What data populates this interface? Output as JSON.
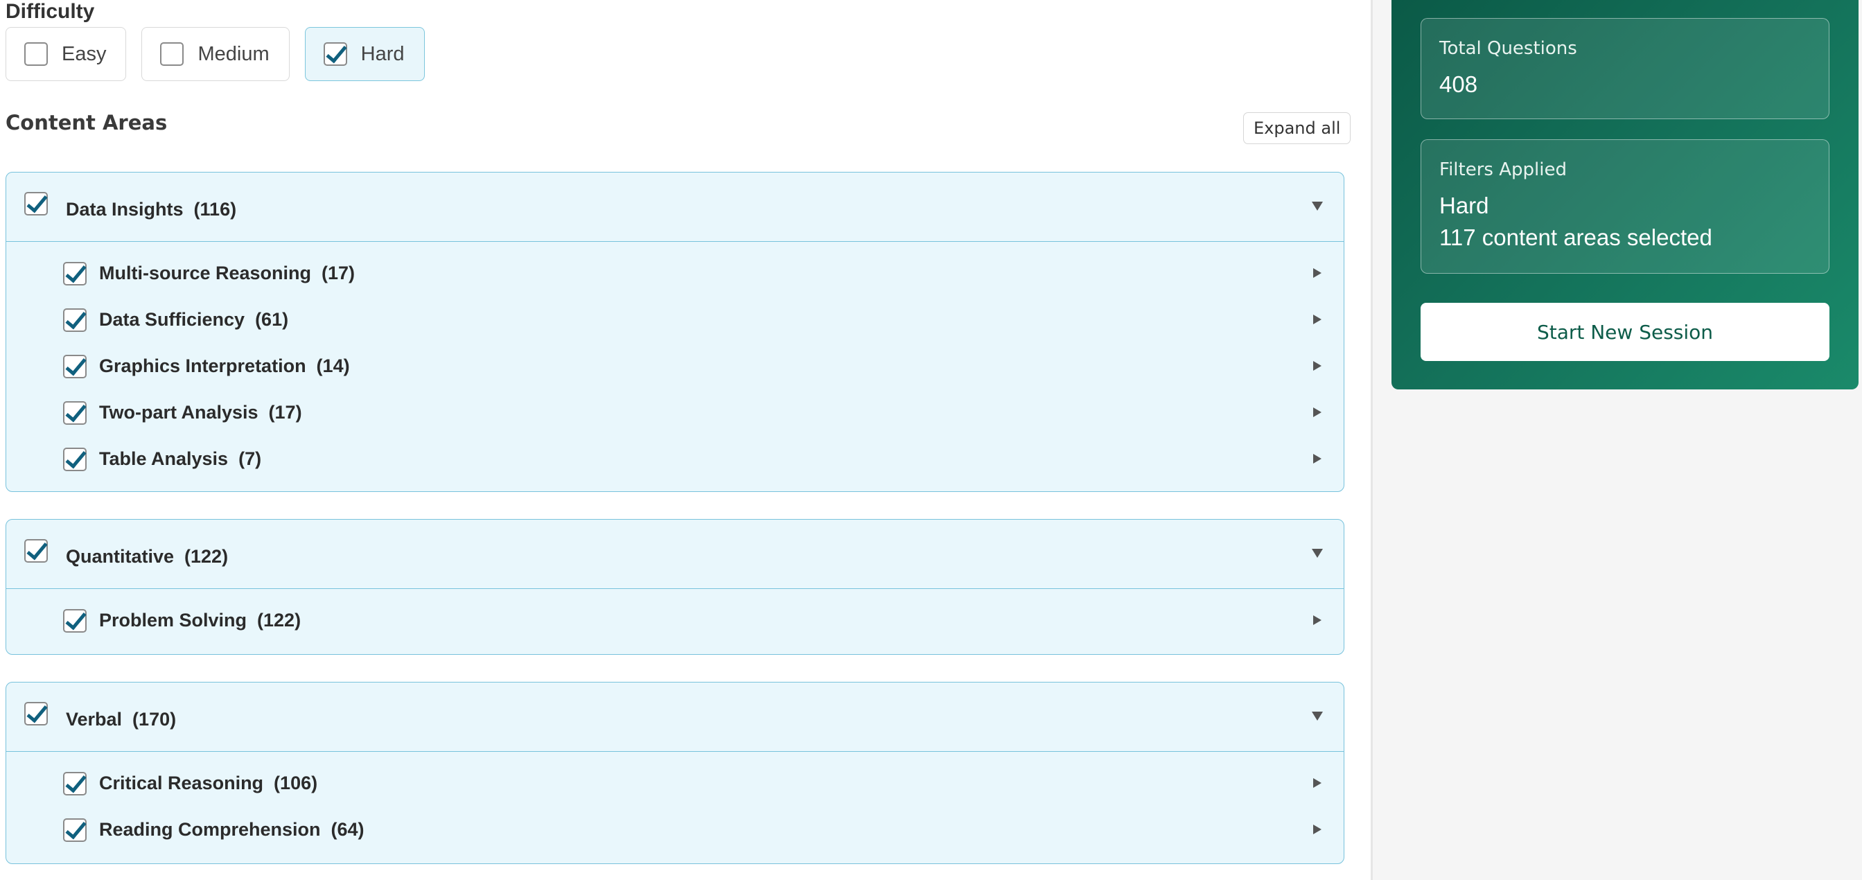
{
  "difficulty": {
    "title": "Difficulty",
    "options": [
      {
        "label": "Easy",
        "checked": false
      },
      {
        "label": "Medium",
        "checked": false
      },
      {
        "label": "Hard",
        "checked": true
      }
    ]
  },
  "content": {
    "title": "Content Areas",
    "expand_all_label": "Expand all",
    "groups": [
      {
        "label": "Data Insights  (116)",
        "checked": true,
        "items": [
          {
            "label": "Multi-source Reasoning  (17)",
            "checked": true
          },
          {
            "label": "Data Sufficiency  (61)",
            "checked": true
          },
          {
            "label": "Graphics Interpretation  (14)",
            "checked": true
          },
          {
            "label": "Two-part Analysis  (17)",
            "checked": true
          },
          {
            "label": "Table Analysis  (7)",
            "checked": true
          }
        ]
      },
      {
        "label": "Quantitative  (122)",
        "checked": true,
        "items": [
          {
            "label": "Problem Solving  (122)",
            "checked": true
          }
        ]
      },
      {
        "label": "Verbal  (170)",
        "checked": true,
        "items": [
          {
            "label": "Critical Reasoning  (106)",
            "checked": true
          },
          {
            "label": "Reading Comprehension  (64)",
            "checked": true
          }
        ]
      }
    ]
  },
  "summary": {
    "total_label": "Total Questions",
    "total_value": "408",
    "filters_label": "Filters Applied",
    "filters_difficulty": "Hard",
    "filters_areas": "117 content areas selected",
    "start_label": "Start New Session"
  },
  "colors": {
    "accent": "#10607e",
    "panel_green": "#136f58",
    "selected_bg": "#e9f7fc",
    "selected_border": "#78c2dc"
  }
}
